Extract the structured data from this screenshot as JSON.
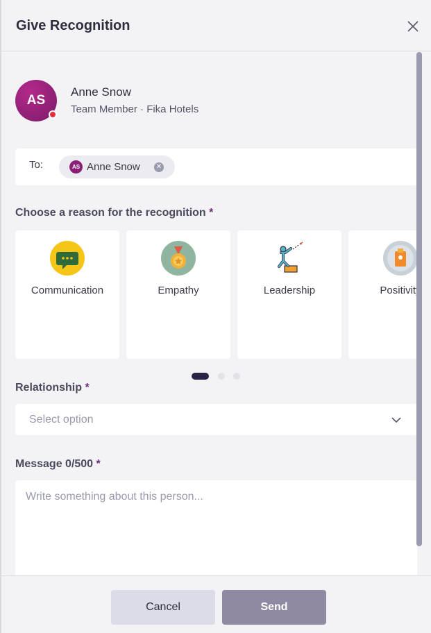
{
  "header": {
    "title": "Give Recognition",
    "close_icon": "close-icon"
  },
  "user": {
    "initials": "AS",
    "name": "Anne Snow",
    "subtitle": "Team Member · Fika Hotels",
    "status_color": "#e02e3a"
  },
  "to": {
    "label": "To:",
    "recipients": [
      {
        "initials": "AS",
        "name": "Anne Snow"
      }
    ]
  },
  "reason": {
    "label": "Choose a reason for the recognition",
    "required_mark": "*",
    "cards": [
      {
        "label": "Communication",
        "icon": "speech-bubble-icon"
      },
      {
        "label": "Empathy",
        "icon": "medal-icon"
      },
      {
        "label": "Leadership",
        "icon": "climbing-person-icon"
      },
      {
        "label": "Positivity",
        "icon": "positivity-icon"
      }
    ],
    "pagination": {
      "pages": 3,
      "current": 1
    }
  },
  "relationship": {
    "label": "Relationship",
    "required_mark": "*",
    "placeholder": "Select option"
  },
  "message": {
    "label": "Message 0/500",
    "required_mark": "*",
    "placeholder": "Write something about this person..."
  },
  "footer": {
    "cancel_label": "Cancel",
    "send_label": "Send"
  },
  "colors": {
    "accent": "#2b2346",
    "send_bg": "#8f8aa2",
    "avatar": "#8a1f78"
  }
}
